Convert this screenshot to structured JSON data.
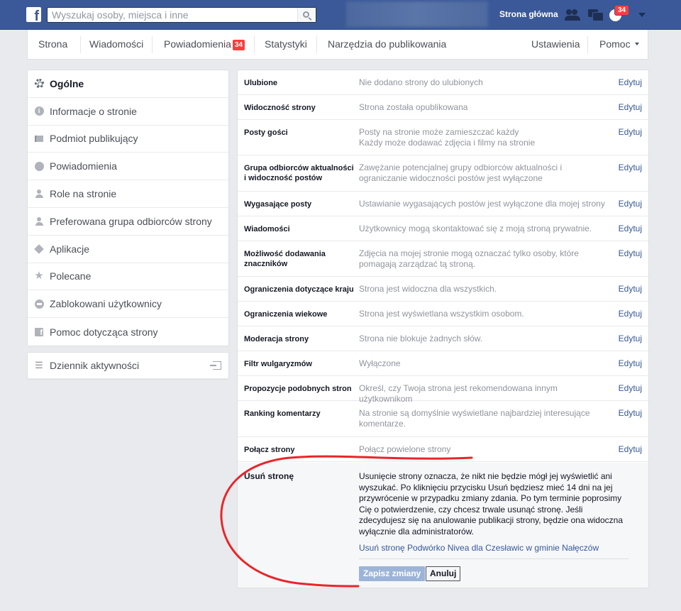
{
  "topbar": {
    "logo": "f",
    "search_placeholder": "Wyszukaj osoby, miejsca i inne",
    "home_link": "Strona główna",
    "notif_count": "34"
  },
  "admin_nav": {
    "items": [
      {
        "label": "Strona"
      },
      {
        "label": "Wiadomości"
      },
      {
        "label": "Powiadomienia",
        "badge": "34"
      },
      {
        "label": "Statystyki"
      },
      {
        "label": "Narzędzia do publikowania"
      }
    ],
    "settings": "Ustawienia",
    "help": "Pomoc"
  },
  "sidebar": {
    "items": [
      {
        "label": "Ogólne",
        "icon": "gear-icon"
      },
      {
        "label": "Informacje o stronie",
        "icon": "info-icon"
      },
      {
        "label": "Podmiot publikujący",
        "icon": "flag-icon"
      },
      {
        "label": "Powiadomienia",
        "icon": "globe-icon"
      },
      {
        "label": "Role na stronie",
        "icon": "person-icon"
      },
      {
        "label": "Preferowana grupa odbiorców strony",
        "icon": "person-star-icon"
      },
      {
        "label": "Aplikacje",
        "icon": "cube-icon"
      },
      {
        "label": "Polecane",
        "icon": "star-icon"
      },
      {
        "label": "Zablokowani użytkownicy",
        "icon": "block-icon"
      },
      {
        "label": "Pomoc dotycząca strony",
        "icon": "facebook-icon"
      }
    ],
    "activity_log": "Dziennik aktywności"
  },
  "settings": {
    "edit_label": "Edytuj",
    "rows": [
      {
        "label": "Ulubione",
        "value": "Nie dodano strony do ulubionych"
      },
      {
        "label": "Widoczność strony",
        "value": "Strona została opublikowana"
      },
      {
        "label": "Posty gości",
        "value": "Posty na stronie może zamieszczać każdy\nKażdy może dodawać zdjęcia i filmy na stronie"
      },
      {
        "label": "Grupa odbiorców aktualności i widoczność postów",
        "value": "Zawężanie potencjalnej grupy odbiorców aktualności i ograniczanie widoczności postów jest wyłączone"
      },
      {
        "label": "Wygasające posty",
        "value": "Ustawianie wygasających postów jest wyłączone dla mojej strony"
      },
      {
        "label": "Wiadomości",
        "value": "Użytkownicy mogą skontaktować się z moją stroną prywatnie."
      },
      {
        "label": "Możliwość dodawania znaczników",
        "value": "Zdjęcia na mojej stronie mogą oznaczać tylko osoby, które pomagają zarządzać tą stroną."
      },
      {
        "label": "Ograniczenia dotyczące kraju",
        "value": "Strona jest widoczna dla wszystkich."
      },
      {
        "label": "Ograniczenia wiekowe",
        "value": "Strona jest wyświetlana wszystkim osobom."
      },
      {
        "label": "Moderacja strony",
        "value": "Strona nie blokuje żadnych słów."
      },
      {
        "label": "Filtr wulgaryzmów",
        "value": "Wyłączone"
      },
      {
        "label": "Propozycje podobnych stron",
        "value": "Określ, czy Twoja strona jest rekomendowana innym użytkownikom"
      },
      {
        "label": "Ranking komentarzy",
        "value": "Na stronie są domyślnie wyświetlane najbardziej interesujące komentarze."
      },
      {
        "label": "Połącz strony",
        "value": "Połącz powielone strony"
      }
    ],
    "delete": {
      "label": "Usuń stronę",
      "text": "Usunięcie strony oznacza, że nikt nie będzie mógł jej wyświetlić ani wyszukać. Po kliknięciu przycisku Usuń będziesz mieć 14 dni na jej przywrócenie w przypadku zmiany zdania. Po tym terminie poprosimy Cię o potwierdzenie, czy chcesz trwale usunąć stronę. Jeśli zdecydujesz się na anulowanie publikacji strony, będzie ona widoczna wyłącznie dla administratorów.",
      "link": "Usuń stronę Podwórko Nivea dla Czesławic w gminie Nałęczów",
      "save": "Zapisz zmiany",
      "cancel": "Anuluj"
    }
  },
  "colors": {
    "brand": "#3b5998",
    "link": "#365899",
    "annotation": "#e8262a"
  }
}
